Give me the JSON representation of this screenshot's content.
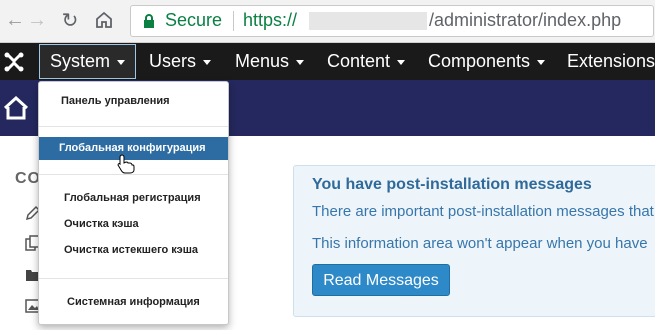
{
  "browser": {
    "secure_label": "Secure",
    "url_scheme": "https://",
    "url_path": "/administrator/index.php",
    "colors": {
      "secure": "#0b8043"
    }
  },
  "topnav": {
    "items": [
      {
        "label": "System"
      },
      {
        "label": "Users"
      },
      {
        "label": "Menus"
      },
      {
        "label": "Content"
      },
      {
        "label": "Components"
      },
      {
        "label": "Extensions"
      }
    ],
    "active_item": "System"
  },
  "dropdown": {
    "items": [
      {
        "label": "Панель управления"
      },
      {
        "label": "Глобальная конфигурация",
        "highlighted": true
      },
      {
        "label": "Глобальная регистрация"
      },
      {
        "label": "Очистка кэша"
      },
      {
        "label": "Очистка истекшего кэша"
      },
      {
        "label": "Системная информация"
      }
    ],
    "highlight_color": "#2d6ca2"
  },
  "sidebar": {
    "heading": "CO",
    "icons": [
      "pencil-icon",
      "copy-icon",
      "folder-icon",
      "image-icon"
    ]
  },
  "message": {
    "title": "You have post-installation messages",
    "paragraph1": "There are important post-installation messages that",
    "paragraph2": "This information area won't appear when you have",
    "button_label": "Read Messages"
  },
  "colors": {
    "topnav_bg": "#1a1a1a",
    "header_bg": "#24285e",
    "accent": "#2d89c8"
  }
}
